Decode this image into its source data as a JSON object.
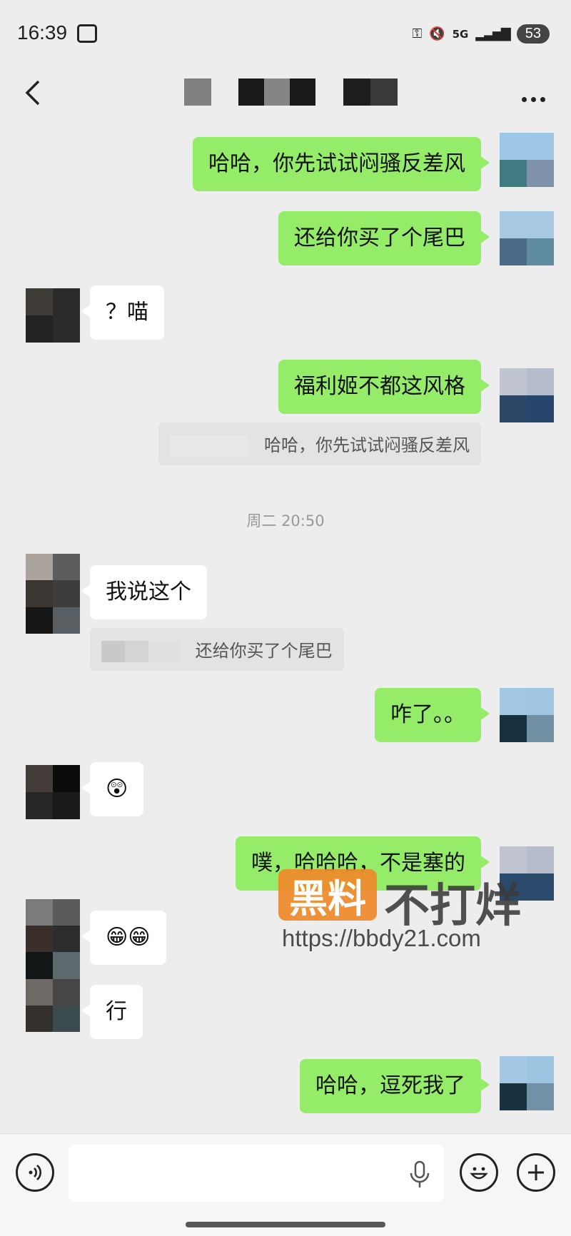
{
  "status_bar": {
    "time": "16:39",
    "network": "5G",
    "battery": "53"
  },
  "messages": [
    {
      "side": "me",
      "text": "哈哈，你先试试闷骚反差风"
    },
    {
      "side": "me",
      "text": "还给你买了个尾巴"
    },
    {
      "side": "them",
      "text": "？喵"
    },
    {
      "side": "me",
      "text": "福利姬不都这风格",
      "quote": "哈哈，你先试试闷骚反差风"
    },
    {
      "side": "them",
      "text": "我说这个",
      "quote": "还给你买了个尾巴"
    },
    {
      "side": "me",
      "text": "咋了。。"
    },
    {
      "side": "them",
      "text": "😲"
    },
    {
      "side": "me",
      "text": "噗，哈哈哈，不是塞的"
    },
    {
      "side": "them",
      "text": "😁😁"
    },
    {
      "side": "them",
      "text": "行"
    },
    {
      "side": "me",
      "text": "哈哈，逗死我了"
    }
  ],
  "timestamp": "周二 20:50",
  "watermark": {
    "badge": "黑料",
    "text": "不打烊",
    "url": "https://bbdy21.com"
  },
  "icons": {
    "back": "chevron-left-icon",
    "more": "more-dots-icon",
    "voice": "voice-icon",
    "mic": "microphone-icon",
    "emoji": "emoji-icon",
    "plus": "plus-icon"
  },
  "colors": {
    "my_bubble": "#95ec69",
    "their_bubble": "#ffffff",
    "background": "#ededed",
    "watermark_badge": "#f08a2a"
  }
}
